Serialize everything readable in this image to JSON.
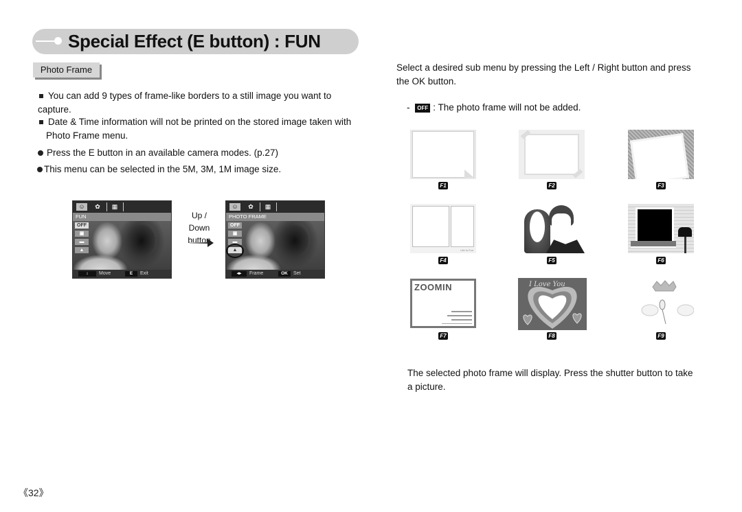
{
  "header": {
    "title": "Special Effect (E button) : FUN"
  },
  "section_tab": "Photo Frame",
  "left_bullets": [
    {
      "marker": "square",
      "text": "You can add 9 types of frame-like borders to a still image you want to capture."
    },
    {
      "marker": "square",
      "text": "Date & Time information will not be printed on the stored image taken with Photo Frame menu."
    },
    {
      "marker": "dot",
      "text": "Press the E button in an available camera modes. (p.27)"
    },
    {
      "marker": "dot",
      "text": "This menu can be selected in the 5M, 3M, 1M image size."
    }
  ],
  "screen1": {
    "menu_title": "FUN",
    "options": [
      "OFF",
      "▣",
      "▬",
      "▲"
    ],
    "footer": {
      "key1": "↕",
      "label1": "Move",
      "key2": "E",
      "label2": "Exit"
    },
    "tab_icons": [
      "face-icon",
      "palette-icon",
      "film-icon"
    ]
  },
  "transition_label": "Up / Down\nbutton",
  "transition_label_lines": [
    "Up / Down",
    "button"
  ],
  "screen2": {
    "menu_title": "PHOTO FRAME",
    "options": [
      "OFF",
      "▣",
      "▬",
      "▲"
    ],
    "selected_option_index": 3,
    "footer": {
      "key1": "◂▸",
      "label1": "Frame",
      "key2": "OK",
      "label2": "Set"
    },
    "tab_icons": [
      "face-icon",
      "palette-icon",
      "film-icon"
    ]
  },
  "right": {
    "instruction": "Select a desired sub menu by pressing the Left / Right button and press the OK button.",
    "off_note": {
      "dash": "-",
      "badge": "OFF",
      "text": ": The photo frame will not be added."
    },
    "frames": [
      {
        "label": "F1",
        "desc": "Curled-corner paper frame"
      },
      {
        "label": "F2",
        "desc": "Taped photo frame"
      },
      {
        "label": "F3",
        "desc": "Tilted polaroid frame"
      },
      {
        "label": "F4",
        "desc": "Comic panels frame"
      },
      {
        "label": "F5",
        "desc": "Couple silhouette frame"
      },
      {
        "label": "F6",
        "desc": "House window frame"
      },
      {
        "label": "F7",
        "desc": "ZOOMIN magazine frame"
      },
      {
        "label": "F8",
        "desc": "I Love You heart frame"
      },
      {
        "label": "F9",
        "desc": "Angel crown and wings frame"
      }
    ],
    "frame_text": {
      "f4_caption": "Life Is Fun",
      "f7_title": "ZOOMIN",
      "f8_text": "I Love You"
    },
    "closing": "The selected photo frame will display. Press the shutter button to take a picture."
  },
  "page_number": "《32》"
}
